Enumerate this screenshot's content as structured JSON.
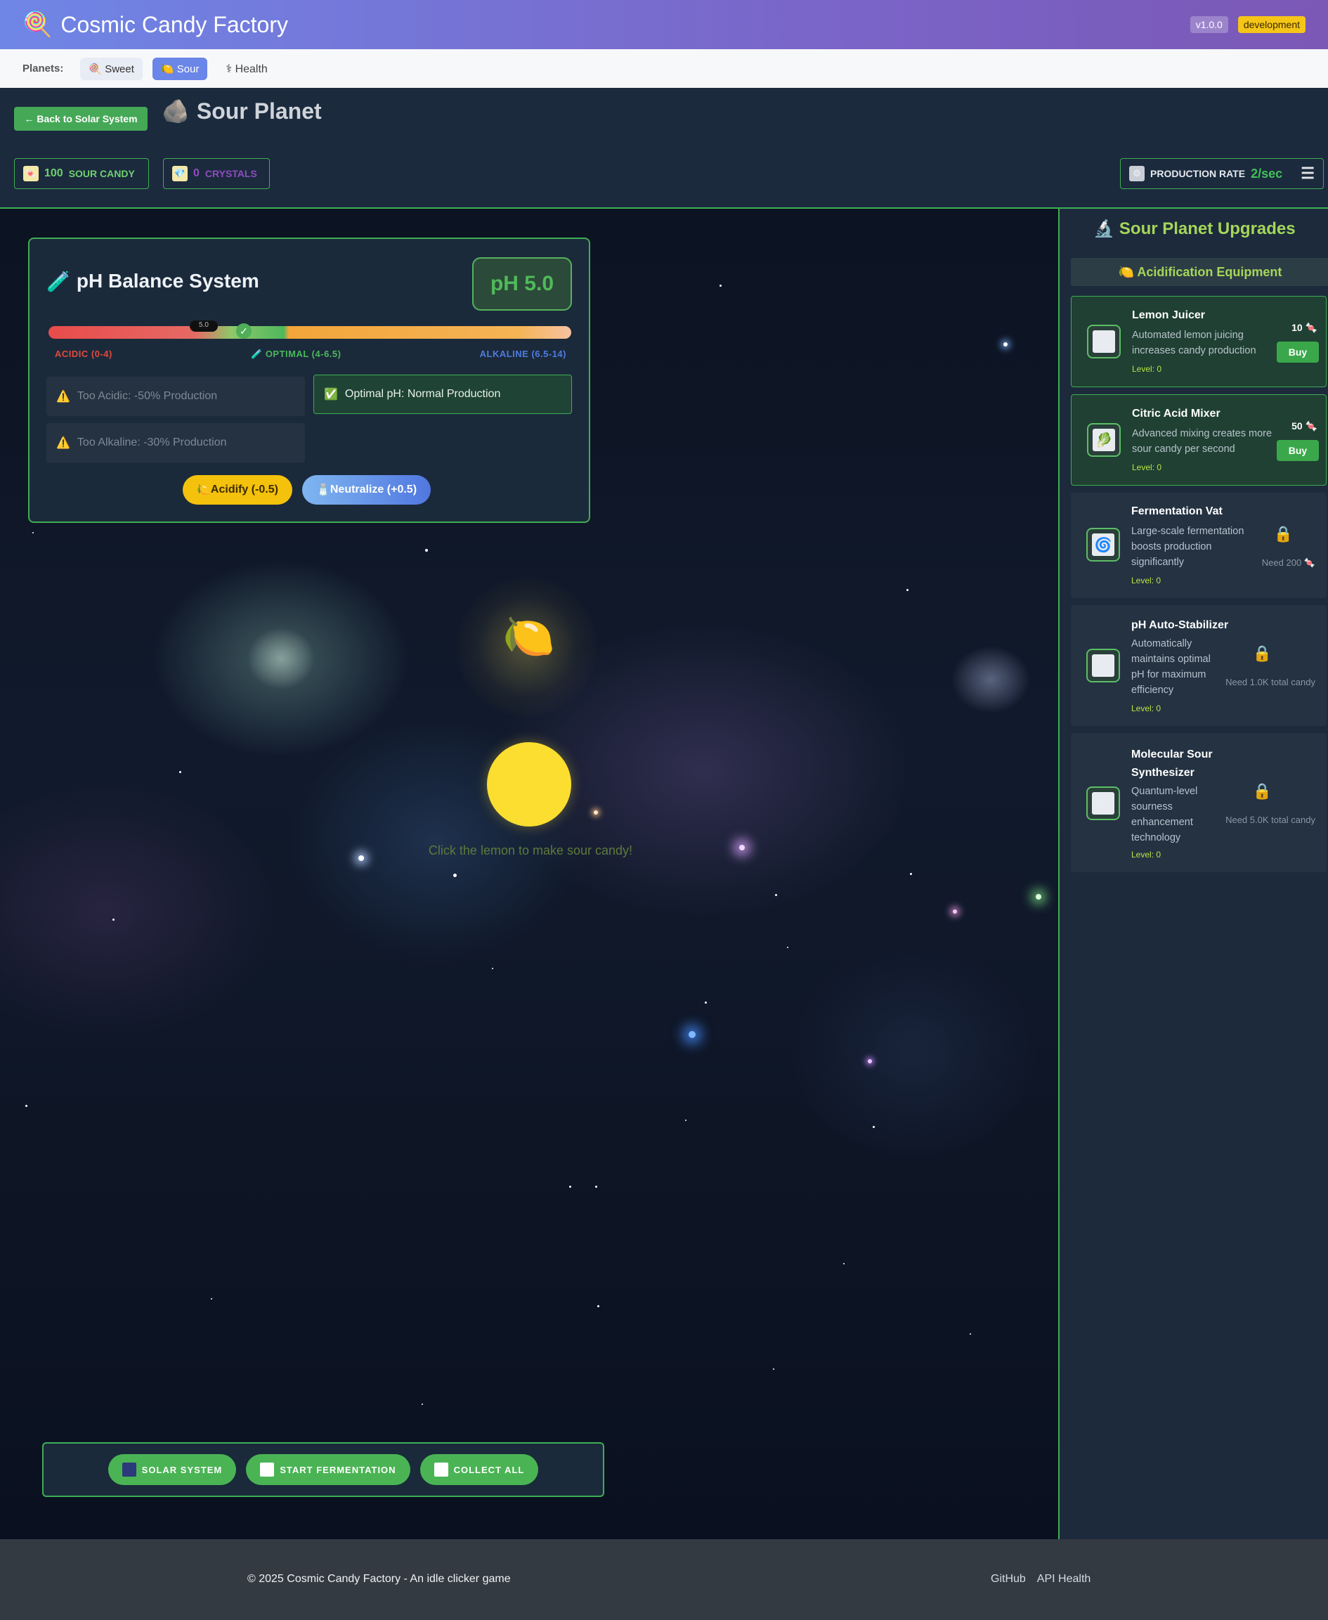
{
  "header": {
    "logo_icon": "lollipop",
    "title": "Cosmic Candy Factory",
    "version": "v1.0.0",
    "environment": "development"
  },
  "nav": {
    "label": "Planets:",
    "items": [
      {
        "icon": "lollipop",
        "label": "Sweet"
      },
      {
        "icon": "lemon",
        "label": "Sour"
      },
      {
        "icon": "caduceus",
        "label": "Health"
      }
    ]
  },
  "planet": {
    "back_label": "← Back to Solar System",
    "title": "Sour Planet",
    "stats": {
      "sour_candy_value": "100",
      "sour_candy_label": "SOUR CANDY",
      "crystals_value": "0",
      "crystals_label": "CRYSTALS",
      "production_label": "PRODUCTION RATE",
      "production_value": "2/sec"
    }
  },
  "ph": {
    "title": "pH Balance System",
    "value_display": "pH 5.0",
    "current": 5.0,
    "marker_label": "5.0",
    "label_acidic": "ACIDIC (0-4)",
    "label_optimal": "OPTIMAL (4-6.5)",
    "label_alkaline": "ALKALINE (6.5-14)",
    "too_acidic": "Too Acidic: -50% Production",
    "optimal": "Optimal pH: Normal Production",
    "too_alkaline": "Too Alkaline: -30% Production",
    "acidify_label": "Acidify (-0.5)",
    "neutralize_label": "Neutralize (+0.5)"
  },
  "clicker": {
    "hint": "Click the lemon to make sour candy!"
  },
  "actions": {
    "solar_system": "SOLAR SYSTEM",
    "start_fermentation": "START FERMENTATION",
    "collect_all": "COLLECT ALL"
  },
  "upgrades": {
    "title": "Sour Planet Upgrades",
    "section": "Acidification Equipment",
    "items": [
      {
        "name": "Lemon Juicer",
        "desc": "Automated lemon juicing increases candy production",
        "level": "Level: 0",
        "cost": "10",
        "buy": "Buy",
        "icon": "gear-icon"
      },
      {
        "name": "Citric Acid Mixer",
        "desc": "Advanced mixing creates more sour candy per second",
        "level": "Level: 0",
        "cost": "50",
        "buy": "Buy",
        "icon": "mixer-icon"
      },
      {
        "name": "Fermentation Vat",
        "desc": "Large-scale fermentation boosts production significantly",
        "level": "Level: 0",
        "need": "Need 200",
        "icon": "swirl-icon"
      },
      {
        "name": "pH Auto-Stabilizer",
        "desc": "Automatically maintains optimal pH for maximum efficiency",
        "level": "Level: 0",
        "need": "Need 1.0K total candy",
        "icon": "stabilizer-icon"
      },
      {
        "name": "Molecular Sour Synthesizer",
        "desc": "Quantum-level sourness enhancement technology",
        "level": "Level: 0",
        "need": "Need 5.0K total candy",
        "icon": "synth-icon"
      }
    ]
  },
  "footer": {
    "copyright": "© 2025 Cosmic Candy Factory - An idle clicker game",
    "link_github": "GitHub",
    "link_api": "API Health"
  },
  "colors": {
    "accent_green": "#3fae54",
    "header_gradient_start": "#6f86e6",
    "header_gradient_end": "#7b58b6",
    "lemon": "#fbde2f"
  }
}
